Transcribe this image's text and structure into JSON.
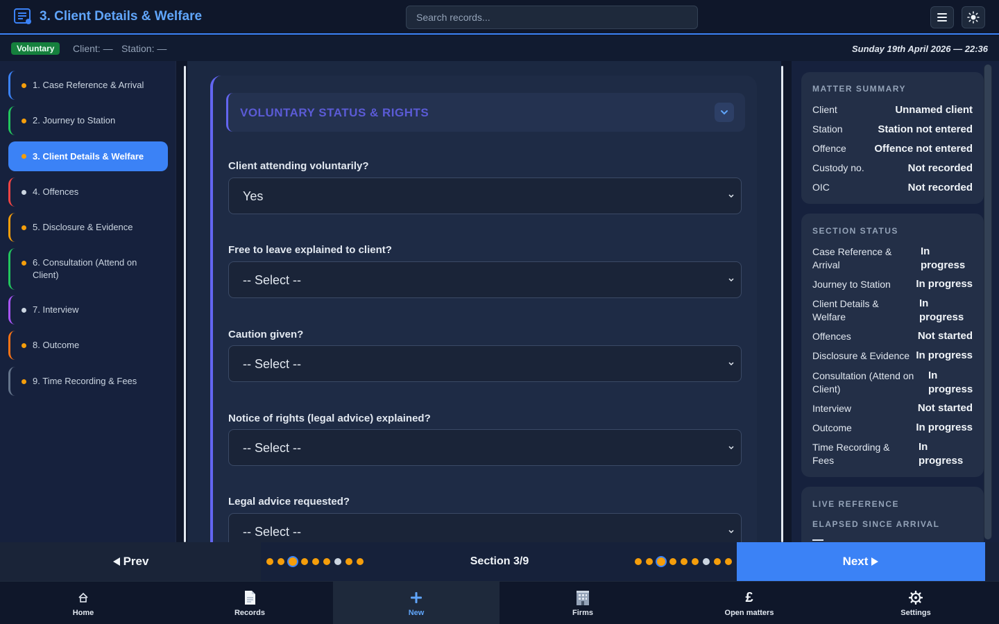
{
  "header": {
    "title": "3. Client Details & Welfare",
    "search_placeholder": "Search records...",
    "menu_icon": "hamburger-menu-icon",
    "theme_icon": "sun-icon"
  },
  "statusbar": {
    "badge": "Voluntary",
    "client": "Client: —",
    "station": "Station: —",
    "datetime": "Sunday 19th April 2026 — 22:36"
  },
  "sidebar": {
    "items": [
      {
        "label": "1. Case Reference & Arrival",
        "dot": "#f59e0b",
        "border": "#3b82f6"
      },
      {
        "label": "2. Journey to Station",
        "dot": "#f59e0b",
        "border": "#22c55e"
      },
      {
        "label": "3. Client Details & Welfare",
        "dot": "#f59e0b",
        "border": "#3b82f6"
      },
      {
        "label": "4. Offences",
        "dot": "#cbd5e1",
        "border": "#ef4444"
      },
      {
        "label": "5. Disclosure & Evidence",
        "dot": "#f59e0b",
        "border": "#f59e0b"
      },
      {
        "label": "6. Consultation (Attend on Client)",
        "dot": "#f59e0b",
        "border": "#22c55e"
      },
      {
        "label": "7. Interview",
        "dot": "#cbd5e1",
        "border": "#a855f7"
      },
      {
        "label": "8. Outcome",
        "dot": "#f59e0b",
        "border": "#f97316"
      },
      {
        "label": "9. Time Recording & Fees",
        "dot": "#f59e0b",
        "border": "#64748b"
      }
    ]
  },
  "form": {
    "section_title": "VOLUNTARY STATUS & RIGHTS",
    "fields": [
      {
        "label": "Client attending voluntarily?",
        "value": "Yes"
      },
      {
        "label": "Free to leave explained to client?",
        "value": "-- Select --"
      },
      {
        "label": "Caution given?",
        "value": "-- Select --"
      },
      {
        "label": "Notice of rights (legal advice) explained?",
        "value": "-- Select --"
      },
      {
        "label": "Legal advice requested?",
        "value": "-- Select --"
      }
    ]
  },
  "summary": {
    "title": "MATTER SUMMARY",
    "rows": [
      {
        "key": "Client",
        "value": "Unnamed client"
      },
      {
        "key": "Station",
        "value": "Station not entered"
      },
      {
        "key": "Offence",
        "value": "Offence not entered"
      },
      {
        "key": "Custody no.",
        "value": "Not recorded"
      },
      {
        "key": "OIC",
        "value": "Not recorded"
      }
    ]
  },
  "section_status": {
    "title": "SECTION STATUS",
    "rows": [
      {
        "key": "Case Reference & Arrival",
        "value": "In progress"
      },
      {
        "key": "Journey to Station",
        "value": "In progress"
      },
      {
        "key": "Client Details & Welfare",
        "value": "In progress"
      },
      {
        "key": "Offences",
        "value": "Not started"
      },
      {
        "key": "Disclosure & Evidence",
        "value": "In progress"
      },
      {
        "key": "Consultation (Attend on Client)",
        "value": "In progress"
      },
      {
        "key": "Interview",
        "value": "Not started"
      },
      {
        "key": "Outcome",
        "value": "In progress"
      },
      {
        "key": "Time Recording & Fees",
        "value": "In progress"
      }
    ]
  },
  "live_reference": {
    "title": "LIVE REFERENCE",
    "subtitle": "ELAPSED SINCE ARRIVAL"
  },
  "pager": {
    "prev": "Prev",
    "next": "Next",
    "counter": "Section 3/9",
    "current_index": 3,
    "total": 9,
    "dot_states": [
      "done",
      "done",
      "current",
      "done",
      "done",
      "done",
      "grey",
      "done",
      "done"
    ]
  },
  "bottomnav": {
    "items": [
      {
        "label": "Home",
        "icon": "home-icon"
      },
      {
        "label": "Records",
        "icon": "document-icon"
      },
      {
        "label": "New",
        "icon": "plus-icon"
      },
      {
        "label": "Firms",
        "icon": "building-icon"
      },
      {
        "label": "Open matters",
        "icon": "pound-icon"
      },
      {
        "label": "Settings",
        "icon": "gear-icon"
      }
    ],
    "active": "New"
  },
  "colors": {
    "accent": "#3b82f6",
    "amber": "#f59e0b",
    "badge": "#15803d",
    "section_accent": "#6366f1"
  }
}
